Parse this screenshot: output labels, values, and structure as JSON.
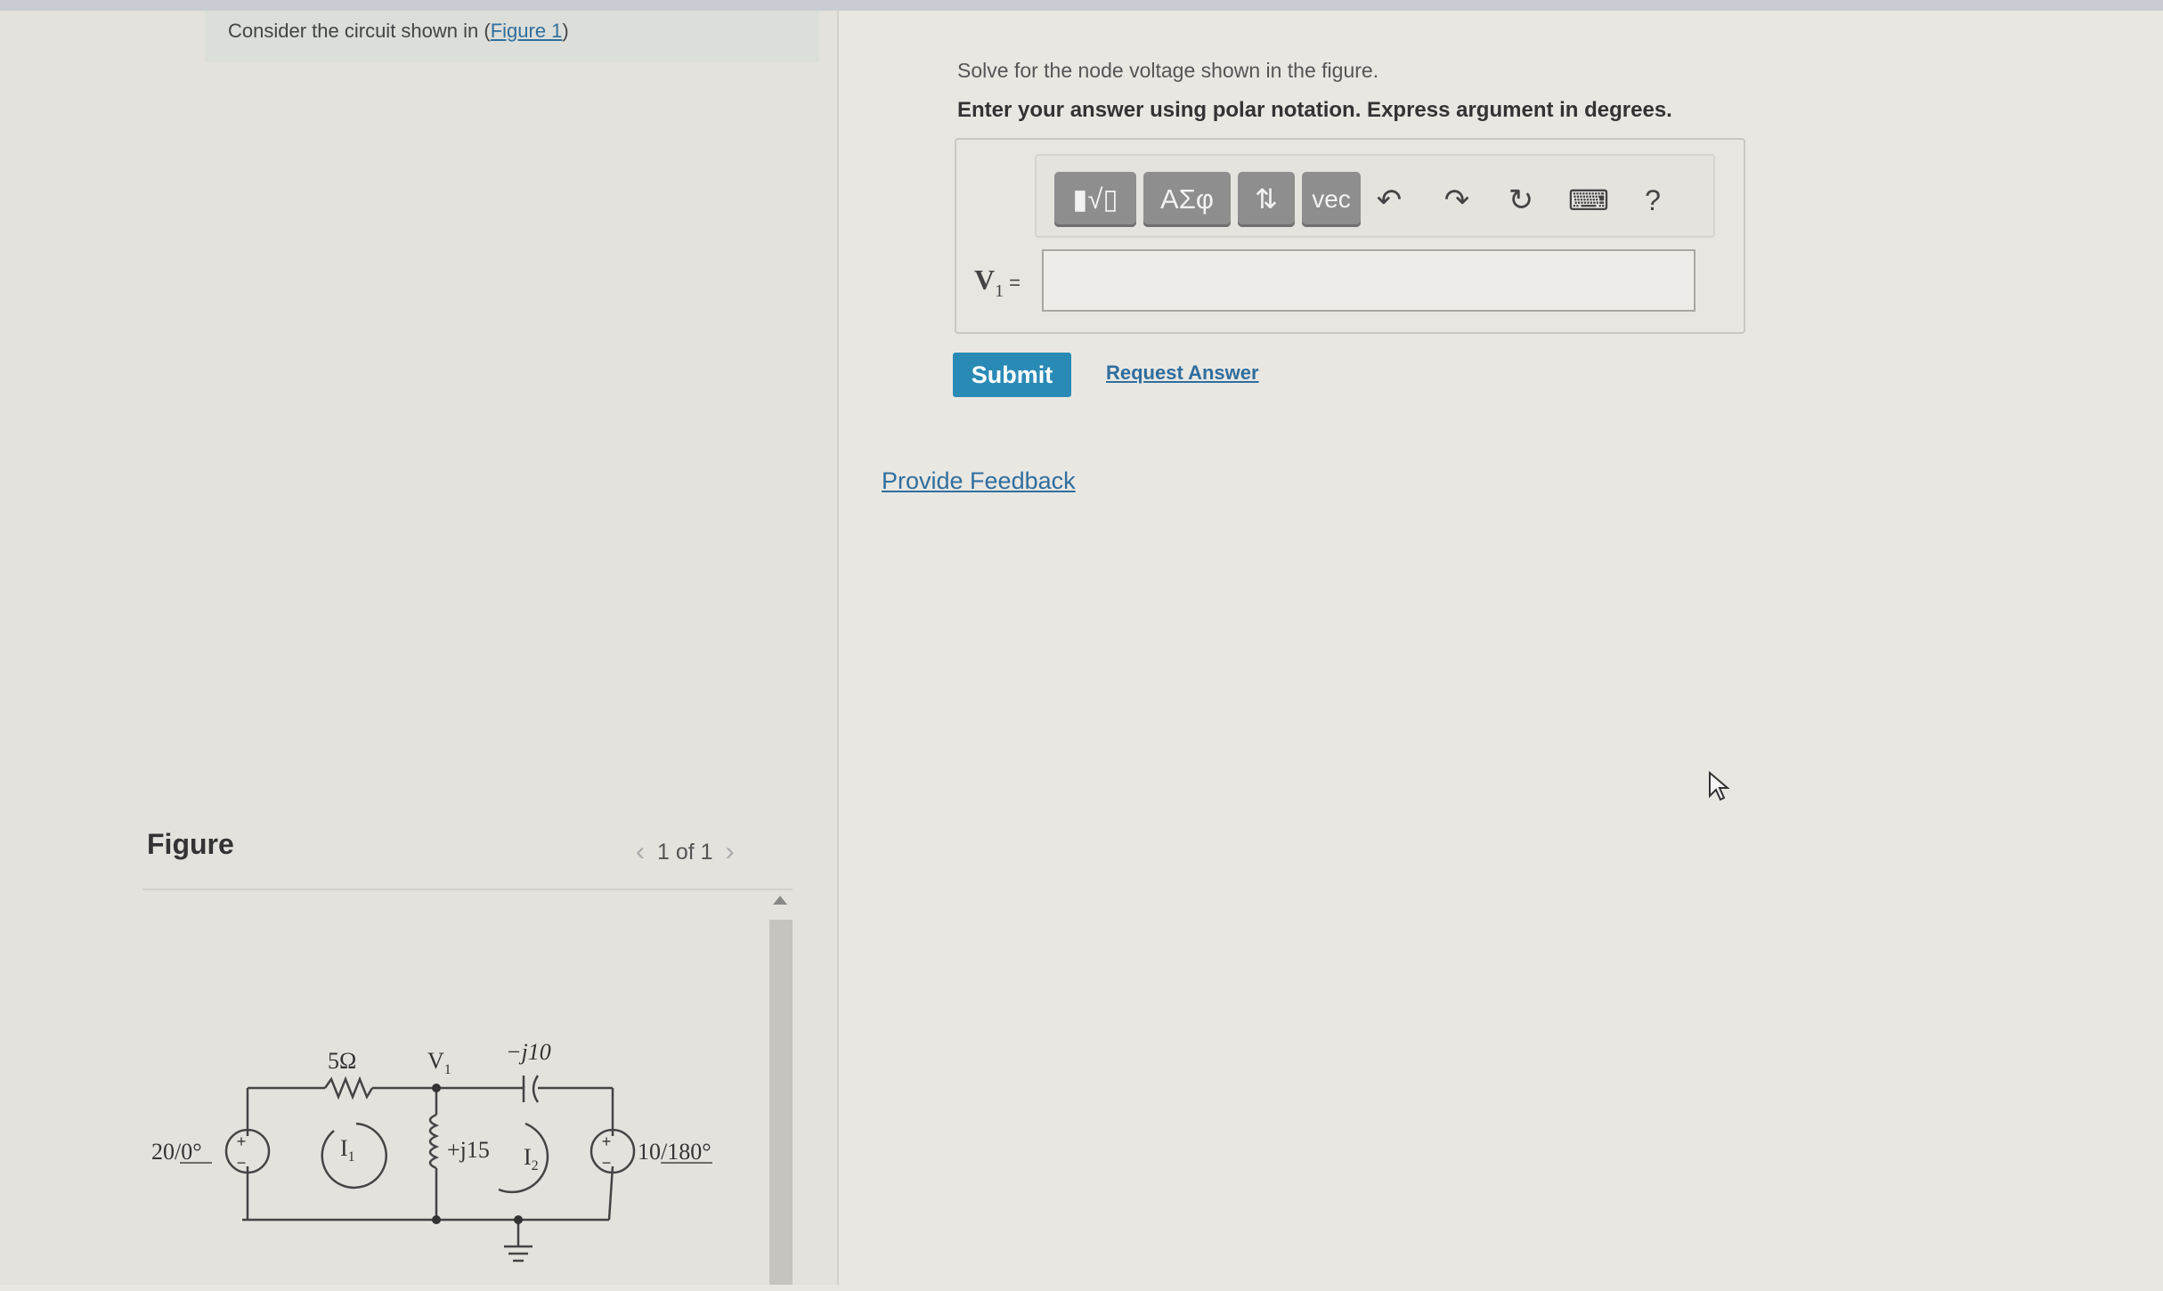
{
  "prompt": {
    "text": "Consider the circuit shown in",
    "open_paren": "(",
    "link": "Figure 1",
    "close_paren": ")"
  },
  "figure": {
    "title": "Figure",
    "pager": {
      "prev_icon": "chevron-left-icon",
      "label": "1 of 1",
      "next_icon": "chevron-right-icon"
    },
    "circuit": {
      "r1": "5Ω",
      "node": "V",
      "node_sub": "1",
      "cap": "−j10",
      "ind": "+j15",
      "src_left": "20",
      "src_left_angle": "0°",
      "src_right": "10",
      "src_right_angle": "180°",
      "mesh1": "I",
      "mesh1_sub": "1",
      "mesh2": "I",
      "mesh2_sub": "2",
      "plus": "+",
      "minus": "−"
    }
  },
  "question": {
    "line1": "Solve for the node voltage shown in the figure.",
    "line2": "Enter your answer using polar notation. Express argument in degrees."
  },
  "toolbar": {
    "buttons": [
      {
        "label": "▮√▯",
        "icon": "template-icon"
      },
      {
        "label": "ΑΣφ",
        "icon": "greek-letters-icon"
      },
      {
        "label": "⇅",
        "icon": "subscript-superscript-icon"
      },
      {
        "label": "vec",
        "icon": "vector-icon"
      }
    ],
    "undo": "↶",
    "redo": "↷",
    "reset": "↻",
    "keyboard": "⌨",
    "help": "?"
  },
  "answer": {
    "label": "V",
    "label_sub": "1",
    "eq": "=",
    "value": ""
  },
  "actions": {
    "submit": "Submit",
    "request": "Request Answer",
    "feedback": "Provide Feedback"
  }
}
